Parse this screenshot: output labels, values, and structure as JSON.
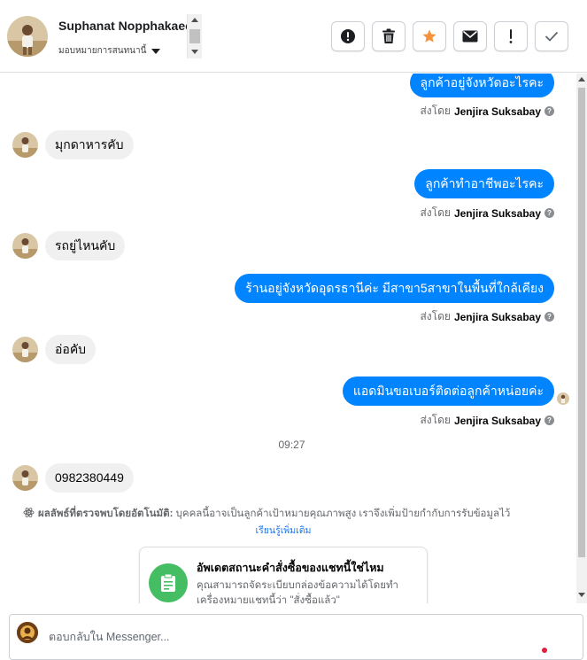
{
  "header": {
    "name": "Suphanat Nopphakaeo",
    "assign_label": "มอบหมายการสนทนานี้",
    "actions": [
      {
        "id": "spam",
        "icon": "alert-circle-icon"
      },
      {
        "id": "delete",
        "icon": "trash-icon"
      },
      {
        "id": "star",
        "icon": "star-icon",
        "color": "#f7923b"
      },
      {
        "id": "unread",
        "icon": "envelope-icon"
      },
      {
        "id": "followup",
        "icon": "exclamation-icon"
      },
      {
        "id": "done",
        "icon": "checkmark-icon"
      }
    ]
  },
  "messages": {
    "m1": {
      "text": "ลูกค้าอยู่จังหวัดอะไรคะ",
      "sent_by_prefix": "ส่งโดย",
      "sender": "Jenjira Suksabay"
    },
    "m2": {
      "text": "มุกดาหารคับ"
    },
    "m3": {
      "text": "ลูกค้าทำอาชีพอะไรคะ",
      "sent_by_prefix": "ส่งโดย",
      "sender": "Jenjira Suksabay"
    },
    "m4": {
      "text": "รถยู่ไหนคับ"
    },
    "m5": {
      "text": "ร้านอยู่จังหวัดอุดรธานีค่ะ มีสาขา5สาขาในพื้นที่ใกล้เคียง",
      "sent_by_prefix": "ส่งโดย",
      "sender": "Jenjira Suksabay"
    },
    "m6": {
      "text": "อ่อคับ"
    },
    "m7": {
      "text": "แอดมินขอเบอร์ติดต่อลูกค้าหน่อยค่ะ",
      "sent_by_prefix": "ส่งโดย",
      "sender": "Jenjira Suksabay"
    },
    "time": "09:27",
    "m8": {
      "text": "0982380449"
    }
  },
  "auto_detect": {
    "label": "ผลลัพธ์ที่ตรวจพบโดยอัตโนมัติ:",
    "text": "บุคคลนี้อาจเป็นลูกค้าเป้าหมายคุณภาพสูง เราจึงเพิ่มป้ายกำกับการรับข้อมูลไว้",
    "learn_more": "เรียนรู้เพิ่มเติม"
  },
  "order_card": {
    "title": "อัพเดตสถานะคำสั่งซื้อของแชทนี้ใช่ไหม",
    "desc": "คุณสามารถจัดระเบียบกล่องข้อความได้โดยทำเครื่องหมายแชทนี้ว่า \"สั่งซื้อแล้ว\""
  },
  "reply": {
    "placeholder": "ตอบกลับใน Messenger..."
  },
  "colors": {
    "outgoing_bubble": "#0084ff",
    "incoming_bubble": "#f0f0f0",
    "order_icon_bg": "#45bd62",
    "link": "#1876f2"
  }
}
